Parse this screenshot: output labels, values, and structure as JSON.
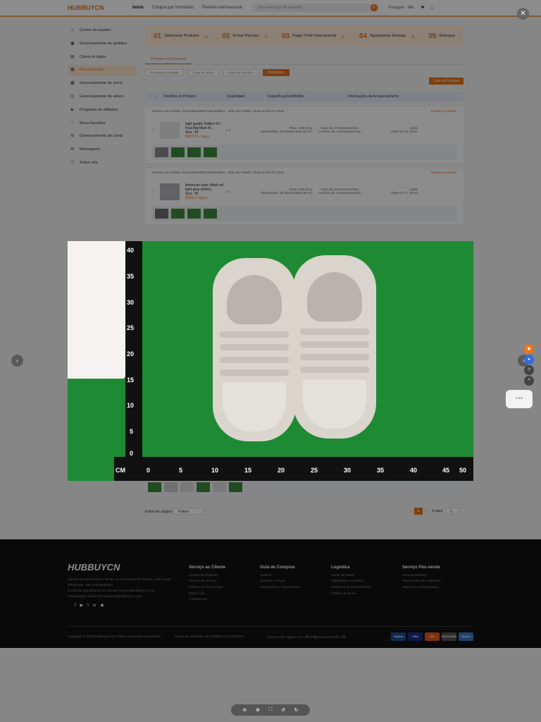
{
  "header": {
    "logo": "HUBBUYCN",
    "nav": [
      "Início",
      "Compra por formulário",
      "Remete internacional"
    ],
    "search_placeholder": "Insira endereço de pesquisa",
    "language": "Português · BRL"
  },
  "sidebar": {
    "items": [
      {
        "label": "Centro do usuário",
        "icon": "user-icon"
      },
      {
        "label": "Gerenciamento de pedidos",
        "icon": "box-icon"
      },
      {
        "label": "Check-in diário",
        "icon": "calendar-icon"
      },
      {
        "label": "Meu depósito",
        "icon": "warehouse-icon",
        "active": true
      },
      {
        "label": "Gerenciamento de envio",
        "icon": "truck-icon"
      },
      {
        "label": "Gerenciamento de ativos",
        "icon": "wallet-icon"
      },
      {
        "label": "Programa de afiliados",
        "icon": "people-icon"
      },
      {
        "label": "Meus favoritos",
        "icon": "heart-icon"
      },
      {
        "label": "Gerenciamento de conta",
        "icon": "gear-icon"
      },
      {
        "label": "Mensagens",
        "icon": "message-icon"
      },
      {
        "label": "Sobre nós",
        "icon": "info-icon"
      }
    ]
  },
  "steps": [
    {
      "num": "01",
      "label": "Selecionar Produtos"
    },
    {
      "num": "02",
      "label": "Enviar Pacotes"
    },
    {
      "num": "03",
      "label": "Pagar Frete Internacional"
    },
    {
      "num": "04",
      "label": "Aguardando Entrega"
    },
    {
      "num": "05",
      "label": "Entregue"
    }
  ],
  "tab": "Produto em Estoque",
  "filters": {
    "search": "Pesquisar produto",
    "date_start": "Data de início",
    "date_end": "Data de término",
    "button": "Pesquisar"
  },
  "list_button": "Lista de Pacotes",
  "table_headers": [
    "Detalhes do Produto",
    "Quantidade",
    "Especificações/Modelo",
    "Informações de Armazenamento"
  ],
  "orders": [
    {
      "order_no": "Número do Pedido: OG20251008071951356861",
      "date": "Data do Pedido: 2025-10-08 07:19:51",
      "status": "Pacote pendente",
      "name": "high quality Edition Ri i. Paul Big Mark M...",
      "size": "Size : M",
      "price": "R$37.56 / peça",
      "qty": "x 1",
      "weight_label": "Peso:",
      "weight": "350.00 g",
      "dim_label": "Dimensões:",
      "dims": "28.00x28.00x2.00 cm",
      "stor_days_label": "Dias de Armazenamento:",
      "stor_days": "1dias",
      "stor_date_label": "Horário de Armazenamento:",
      "stor_date": "2025-10-15 19:23"
    },
    {
      "order_no": "Número do Pedido: OG20251008071951356861",
      "date": "Data do Pedido: 2025-10-08 07:19:51",
      "status": "Pacote pendente",
      "name": "American-style Wash ed light gray-dotted...",
      "size": "Size : M",
      "price": "R$31.3 / peça",
      "qty": "x 1",
      "weight_label": "Peso:",
      "weight": "504.00 g",
      "dim_label": "Dimensões:",
      "dims": "36.00x28.00x2.00 cm",
      "stor_days_label": "Dias de Armazenamento:",
      "stor_days": "1dias",
      "stor_date_label": "Horário de Armazenamento:",
      "stor_date": "2025-10-17 18:44"
    }
  ],
  "pager": {
    "per_page_label": "Exibir por página:",
    "per_page": "8 itens",
    "current": "1",
    "goto_label": "Ir para",
    "goto_value": "1"
  },
  "footer": {
    "logo": "HUBBUYCN",
    "info": [
      "Horário de atendimento: 09:00~18:30 Horário de Pequim (7x8 horas)",
      "WhatsApp: +86-13302485420",
      "E-mail de atendimento ao cliente: service@hubbuycn.com",
      "Cooperação comercial: business@hubbuycn.com"
    ],
    "columns": [
      {
        "title": "Serviço ao Cliente",
        "items": [
          "Acordo de Registro",
          "Termos de Serviço",
          "Política de Privacidade",
          "Sobre Nós",
          "Contate-nos"
        ]
      },
      {
        "title": "Guia de Compras",
        "items": [
          "Tutorial",
          "Serviços e Taxas",
          "Devoluções e Reembolsos"
        ]
      },
      {
        "title": "Logística",
        "items": [
          "Custo de Envio",
          "Alfândega e Impostos",
          "Diretrizes de Recebimento",
          "Política de Envio"
        ]
      },
      {
        "title": "Serviço Pós-venda",
        "items": [
          "Armazenamento",
          "Informações de Inspeção",
          "Seguro e Compensação"
        ]
      }
    ],
    "copyright": "Copyright © 2025 hubbuycn.com Todos os direitos reservados",
    "company": "Nome da empresa: HK HUBBUYCN LIMITED",
    "icp": "Número de registro ICP: 粤ICP备2024316384号-1号",
    "cards": [
      "PayPal",
      "VISA",
      "MC",
      "DISCOVER",
      "Diners"
    ]
  },
  "viewer": {
    "ruler_v_labels": [
      "40",
      "35",
      "30",
      "25",
      "20",
      "15",
      "10",
      "5",
      "0"
    ],
    "ruler_h_labels": [
      "CM",
      "0",
      "5",
      "10",
      "15",
      "20",
      "25",
      "30",
      "35",
      "40",
      "45",
      "50"
    ],
    "colors": {
      "accent": "#e8731a",
      "photo_bg": "#1e8a34"
    }
  }
}
